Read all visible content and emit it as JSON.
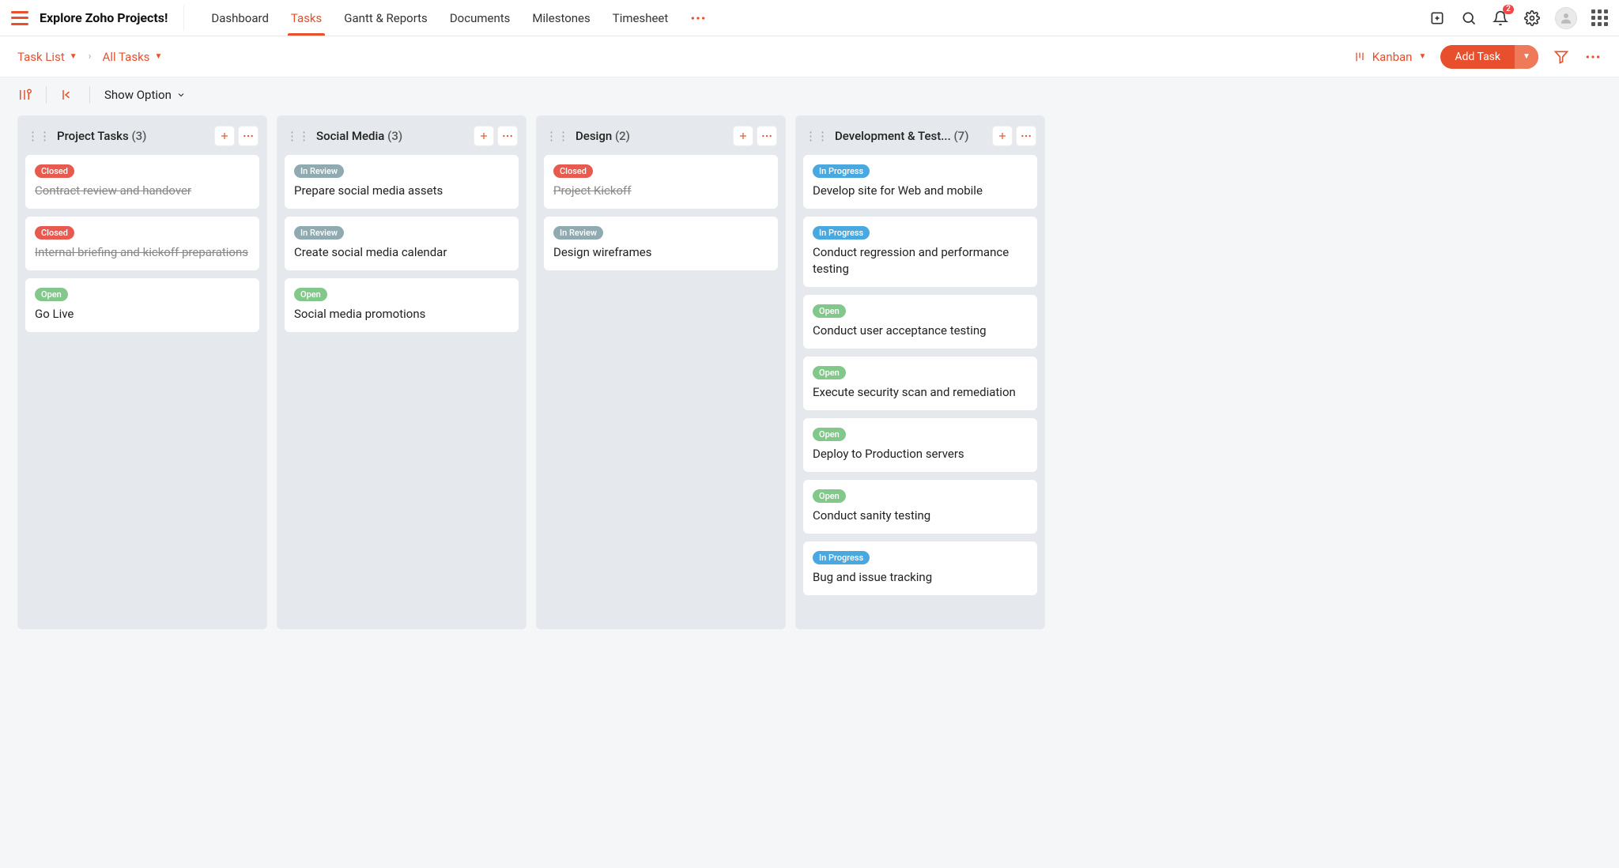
{
  "header": {
    "app_title": "Explore Zoho Projects!",
    "tabs": [
      "Dashboard",
      "Tasks",
      "Gantt & Reports",
      "Documents",
      "Milestones",
      "Timesheet"
    ],
    "active_tab_index": 1,
    "notification_count": "2"
  },
  "subbar": {
    "crumb_main": "Task List",
    "crumb_sub": "All Tasks",
    "view_label": "Kanban",
    "add_button": "Add Task"
  },
  "toolbar": {
    "show_option": "Show Option"
  },
  "status_labels": {
    "closed": "Closed",
    "open": "Open",
    "inreview": "In Review",
    "inprogress": "In Progress"
  },
  "columns": [
    {
      "title": "Project Tasks",
      "count": "(3)",
      "cards": [
        {
          "status": "closed",
          "title": "Contract review and handover",
          "strike": true
        },
        {
          "status": "closed",
          "title": "Internal briefing and kickoff preparations",
          "strike": true
        },
        {
          "status": "open",
          "title": "Go Live",
          "strike": false
        }
      ]
    },
    {
      "title": "Social Media",
      "count": "(3)",
      "cards": [
        {
          "status": "inreview",
          "title": "Prepare social media assets",
          "strike": false
        },
        {
          "status": "inreview",
          "title": "Create social media calendar",
          "strike": false
        },
        {
          "status": "open",
          "title": "Social media promotions",
          "strike": false
        }
      ]
    },
    {
      "title": "Design",
      "count": "(2)",
      "cards": [
        {
          "status": "closed",
          "title": "Project Kickoff",
          "strike": true
        },
        {
          "status": "inreview",
          "title": "Design wireframes",
          "strike": false
        }
      ]
    },
    {
      "title": "Development & Test...",
      "count": "(7)",
      "cards": [
        {
          "status": "inprogress",
          "title": "Develop site for Web and mobile",
          "strike": false
        },
        {
          "status": "inprogress",
          "title": "Conduct regression and performance testing",
          "strike": false
        },
        {
          "status": "open",
          "title": "Conduct user acceptance testing",
          "strike": false
        },
        {
          "status": "open",
          "title": "Execute security scan and remediation",
          "strike": false
        },
        {
          "status": "open",
          "title": "Deploy to Production servers",
          "strike": false
        },
        {
          "status": "open",
          "title": "Conduct sanity testing",
          "strike": false
        },
        {
          "status": "inprogress",
          "title": "Bug and issue tracking",
          "strike": false
        }
      ]
    }
  ]
}
